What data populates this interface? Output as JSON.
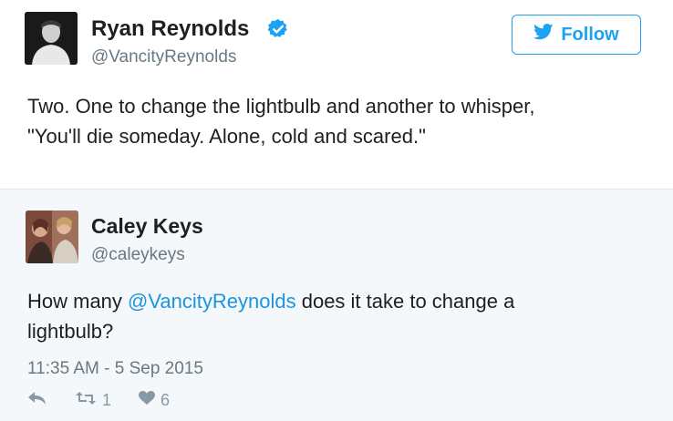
{
  "author": {
    "name": "Ryan Reynolds",
    "handle": "@VancityReynolds",
    "verified_icon": "verified-badge-icon"
  },
  "follow_button": {
    "label": "Follow",
    "icon": "bird-icon",
    "color": "#1da1f2"
  },
  "main_tweet": {
    "line1": "Two. One to change the lightbulb and another to whisper,",
    "line2": "\"You'll die someday. Alone, cold and scared.\""
  },
  "reply": {
    "name": "Caley Keys",
    "handle": "@caleykeys",
    "text_before": "How many ",
    "mention": "@VancityReynolds",
    "text_after": " does it take to change a",
    "text_line2": "lightbulb?",
    "timestamp": "11:35 AM - 5 Sep 2015",
    "retweet_count": "1",
    "like_count": "6"
  },
  "colors": {
    "accent": "#1da1f2",
    "mention": "#1b95e0",
    "quoted_bg": "#f5f8fa",
    "muted": "#697882"
  }
}
